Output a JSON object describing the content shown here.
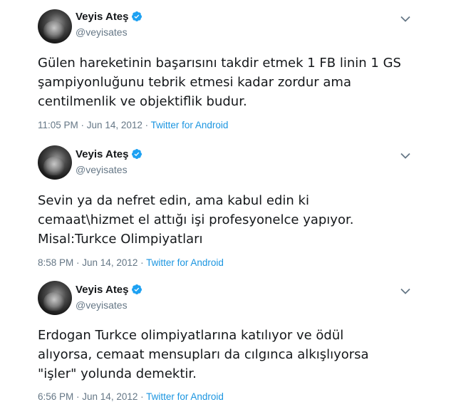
{
  "tweets": [
    {
      "display_name": "Veyis Ateş",
      "handle": "@veyisates",
      "text": "Gülen hareketinin başarısını takdir etmek 1 FB linin 1 GS\nşampiyonluğunu tebrik etmesi kadar zordur ama\ncentilmenlik ve objektiflik budur.",
      "time": "11:05 PM",
      "date": "Jun 14, 2012",
      "source": "Twitter for Android"
    },
    {
      "display_name": "Veyis Ateş",
      "handle": "@veyisates",
      "text": "Sevin ya da nefret edin, ama kabul edin ki\ncemaat\\hizmet el attığı işi profesyonelce yapıyor.\nMisal:Turkce Olimpiyatları",
      "time": "8:58 PM",
      "date": "Jun 14, 2012",
      "source": "Twitter for Android"
    },
    {
      "display_name": "Veyis Ateş",
      "handle": "@veyisates",
      "text": "Erdogan Turkce olimpiyatlarına katılıyor ve ödül\nalıyorsa, cemaat mensupları da cılgınca alkışlıyorsa\n\"işler\" yolunda demektir.",
      "time": "6:56 PM",
      "date": "Jun 14, 2012",
      "source": "Twitter for Android"
    }
  ],
  "separator": " · ",
  "icons": {
    "verified": "verified-badge-icon",
    "menu": "chevron-down-icon"
  },
  "colors": {
    "verified": "#1da1f2",
    "secondary_text": "#657786",
    "link": "#1b95e0"
  }
}
